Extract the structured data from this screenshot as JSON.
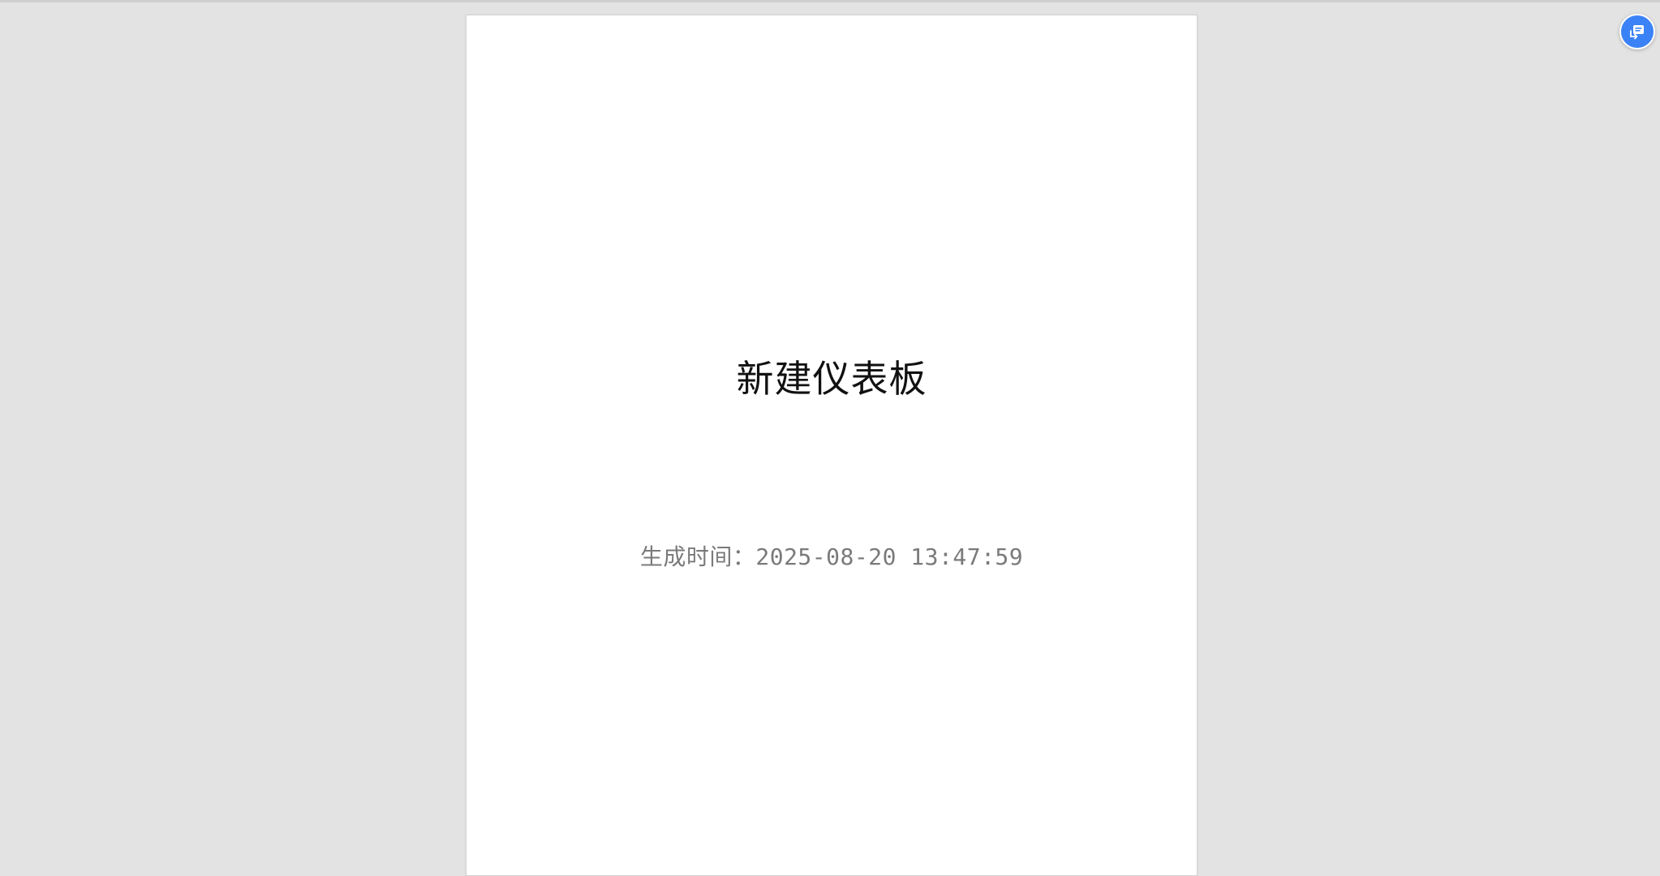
{
  "document": {
    "title": "新建仪表板",
    "generated_label": "生成时间：",
    "generated_time": "2025-08-20 13:47:59"
  },
  "floating_action": {
    "icon": "translate-icon",
    "color": "#3b82f6"
  }
}
